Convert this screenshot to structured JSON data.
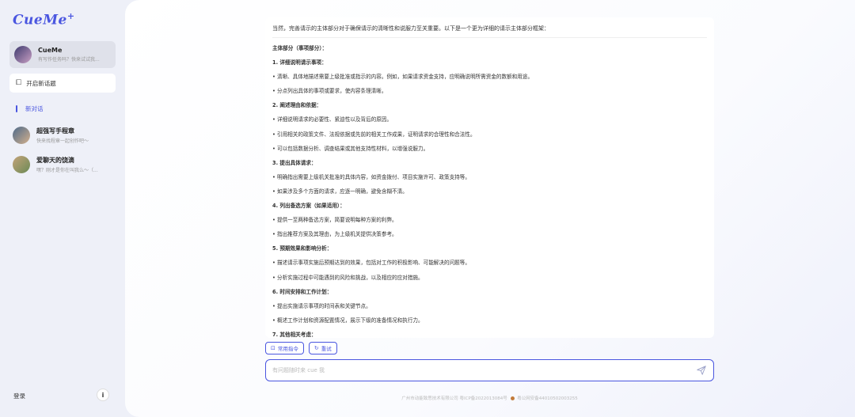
{
  "sidebar": {
    "logo": "CueMe",
    "logo_mark": "+",
    "agent": {
      "title": "CueMe",
      "subtitle": "有写作任务吗？快来试试我..."
    },
    "new_chat": "开启新话题",
    "section": "新对话",
    "chats": [
      {
        "title": "超强写手程章",
        "subtitle": "快来找程章一起创作吧～"
      },
      {
        "title": "爱聊天的饶滴",
        "subtitle": "嘿？刚才是你在叫我么～（..."
      }
    ],
    "login": "登录",
    "info": "i"
  },
  "content": {
    "intro": "当然，完善请示的主体部分对于确保请示的清晰性和说服力至关重要。以下是一个更为详细的请示主体部分框架：",
    "lines": [
      {
        "text": "主体部分（事项部分）：",
        "bold": true
      },
      {
        "text": "1. 详细说明请示事项：",
        "bold": true
      },
      {
        "text": "• 清晰、具体地描述需要上级批准或指示的内容。例如，如果请求资金支持，应明确说明所需资金的数额和用途。",
        "bold": false
      },
      {
        "text": "• 分点列出具体的事项或要求，使内容条理清晰。",
        "bold": false
      },
      {
        "text": "2. 阐述理由和依据：",
        "bold": true
      },
      {
        "text": "• 详细说明请求的必要性、紧迫性以及背后的原因。",
        "bold": false
      },
      {
        "text": "• 引用相关的政策文件、法规依据或先前的相关工作成果，证明请求的合理性和合法性。",
        "bold": false
      },
      {
        "text": "• 可以包括数据分析、调查结果或其他支持性材料，以增强说服力。",
        "bold": false
      },
      {
        "text": "3. 提出具体请求：",
        "bold": true
      },
      {
        "text": "• 明确指出需要上级机关批准的具体内容，如资金拨付、项目实施许可、政策支持等。",
        "bold": false
      },
      {
        "text": "• 如果涉及多个方面的请求，应逐一明确，避免含糊不清。",
        "bold": false
      },
      {
        "text": "4. 列出备选方案（如果适用）：",
        "bold": true
      },
      {
        "text": "• 提供一至两种备选方案，简要说明每种方案的利弊。",
        "bold": false
      },
      {
        "text": "• 指出推荐方案及其理由，为上级机关提供决策参考。",
        "bold": false
      },
      {
        "text": "5. 预期效果和影响分析：",
        "bold": true
      },
      {
        "text": "• 描述请示事项实施后预期达到的效果，包括对工作的积极影响、可能解决的问题等。",
        "bold": false
      },
      {
        "text": "• 分析实施过程中可能遇到的风险和挑战，以及相应的应对措施。",
        "bold": false
      },
      {
        "text": "6. 时间安排和工作计划：",
        "bold": true
      },
      {
        "text": "• 提出实施请示事项的时间表和关键节点。",
        "bold": false
      },
      {
        "text": "• 概述工作计划和资源配置情况，展示下级的准备情况和执行力。",
        "bold": false
      },
      {
        "text": "7. 其他相关考虑：",
        "bold": true
      }
    ]
  },
  "actions": {
    "common": "常用指令",
    "retry": "重试"
  },
  "input": {
    "placeholder": "有问题随时来 cue 我"
  },
  "footer": {
    "icp": "广州市动能致思技术有限公司 粤ICP备2022013084号",
    "police": "粤公网安备44010502003255"
  },
  "colors": {
    "accent": "#4a56e0"
  }
}
